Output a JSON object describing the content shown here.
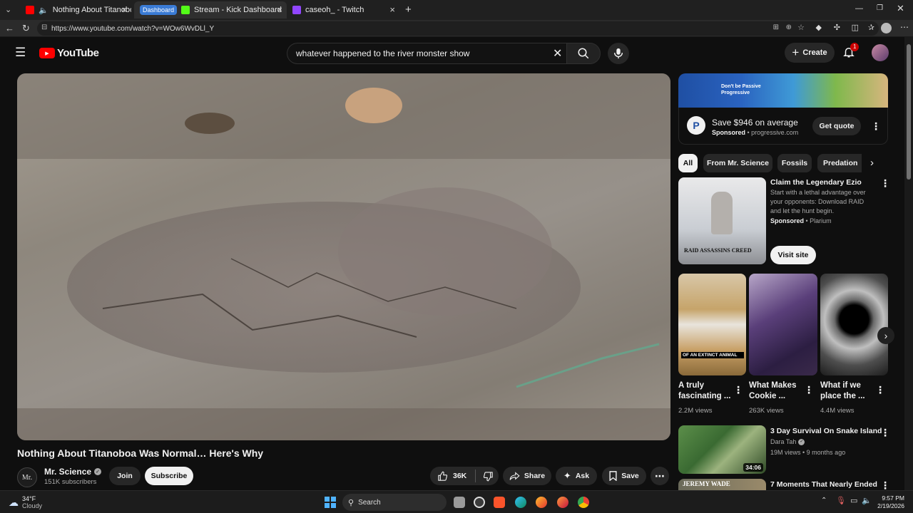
{
  "browser": {
    "tabs": [
      {
        "title": "Nothing About Titanoboa Wa",
        "favicon_color": "#ff0000"
      },
      {
        "group": "Dashboard",
        "title": "Stream - Kick Dashboard",
        "favicon_color": "#53fc18"
      },
      {
        "title": "caseoh_ - Twitch",
        "favicon_color": "#9146ff"
      }
    ],
    "url": "https://www.youtube.com/watch?v=WOw6WvDLl_Y"
  },
  "yt": {
    "logo": "YouTube",
    "search_value": "whatever happened to the river monster show",
    "create_label": "Create",
    "notification_count": "1"
  },
  "video": {
    "title": "Nothing About Titanoboa Was Normal… Here's Why",
    "channel": "Mr. Science",
    "avatar_text": "Mr.",
    "subscribers": "151K subscribers",
    "join_label": "Join",
    "subscribe_label": "Subscribe",
    "likes": "36K",
    "share_label": "Share",
    "ask_label": "Ask",
    "save_label": "Save"
  },
  "ad": {
    "banner_text": "Don't be Passive Progressive",
    "headline": "Save $946 on average",
    "sponsored": "Sponsored",
    "domain": "progressive.com",
    "cta": "Get quote"
  },
  "chips": [
    "All",
    "From Mr. Science",
    "Fossils",
    "Predation"
  ],
  "sponsored_card": {
    "title": "Claim the Legendary Ezio",
    "desc": "Start with a lethal advantage over your opponents: Download RAID and let the hunt begin.",
    "sponsored": "Sponsored",
    "advertiser": "Plarium",
    "cta": "Visit site",
    "thumb_text": "RAID ASSASSINS CREED"
  },
  "shorts": [
    {
      "title": "A truly fascinating ...",
      "views": "2.2M views",
      "caption": "OF AN EXTINCT ANIMAL"
    },
    {
      "title": "What Makes Cookie ...",
      "views": "263K views"
    },
    {
      "title": "What if we place the ...",
      "views": "4.4M views"
    }
  ],
  "recommended": [
    {
      "title": "3 Day Survival On Snake Island",
      "channel": "Dara Tah",
      "meta": "19M views • 9 months ago",
      "duration": "34:06"
    },
    {
      "title": "7 Moments That Nearly Ended",
      "thumb_text": "JEREMY WADE"
    }
  ],
  "taskbar": {
    "temp": "34°F",
    "weather": "Cloudy",
    "search_label": "Search",
    "time": "9:57 PM",
    "date": "2/19/2026"
  }
}
